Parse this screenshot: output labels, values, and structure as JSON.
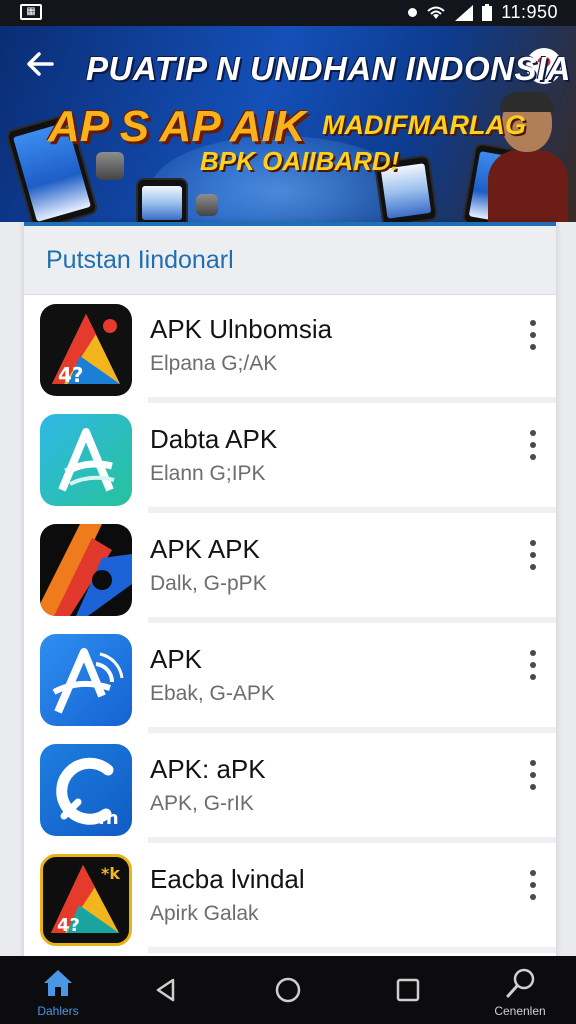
{
  "status_bar": {
    "left_icon": "screenshot-icon",
    "time": "11:950"
  },
  "banner": {
    "title": "PUATIP N UNDHAN INDONSIA",
    "line2": "AP S AP AIK",
    "line2b": "MADIFMARLAG",
    "line3": "BPK OAIIBARD!",
    "back_icon": "arrow-left-icon",
    "help_icon": "question-mark-icon"
  },
  "section": {
    "title": "Putstan Iindonarl"
  },
  "apps": [
    {
      "name": "APK Ulnbomsia",
      "subtitle": "Elpana G;/AK",
      "icon": "triangle-a-dark-icon"
    },
    {
      "name": "Dabta APK",
      "subtitle": "Elann G;IPK",
      "icon": "a-letter-teal-icon"
    },
    {
      "name": "APK APK",
      "subtitle": "Dalk, G-pPK",
      "icon": "diagonal-stripe-icon"
    },
    {
      "name": "APK",
      "subtitle": "Ebak, G-APK",
      "icon": "a-letter-blue-icon"
    },
    {
      "name": "APK: aPK",
      "subtitle": "APK, G-rIK",
      "icon": "c-letter-blue-icon"
    },
    {
      "name": "Eacba lvindal",
      "subtitle": "Apirk Galak",
      "icon": "triangle-a-gold-icon"
    }
  ],
  "bottom_nav": {
    "home_label": "Dahlers",
    "search_label": "Cenenlen",
    "colors": {
      "active": "#4b97e6",
      "inactive": "#d0d0d0"
    }
  },
  "colors": {
    "accent": "#1f6fb2",
    "banner_bg": "#1450b8",
    "highlight": "#f7b21c"
  }
}
